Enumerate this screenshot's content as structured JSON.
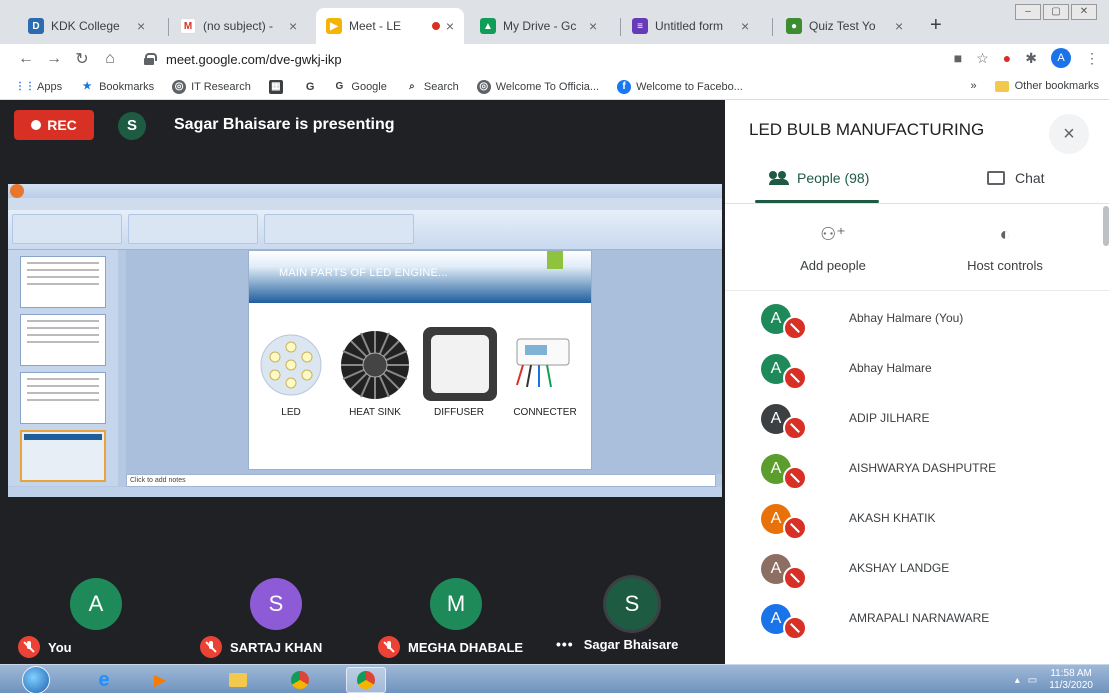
{
  "browser": {
    "tabs": [
      {
        "title": "KDK College",
        "favicon_color": "#2b6cb0",
        "favicon": "D"
      },
      {
        "title": "(no subject) -",
        "favicon_color": "#ffffff",
        "favicon": "M"
      },
      {
        "title": "Meet - LE",
        "favicon_color": "#f4b400",
        "favicon": "▶"
      },
      {
        "title": "My Drive - Gc",
        "favicon_color": "#0f9d58",
        "favicon": "▲"
      },
      {
        "title": "Untitled form",
        "favicon_color": "#673ab7",
        "favicon": "≡"
      },
      {
        "title": "Quiz Test Yo",
        "favicon_color": "#3c8d2f",
        "favicon": "●"
      }
    ],
    "url": "meet.google.com/dve-gwkj-ikp",
    "profile_initial": "A",
    "bookmarks": [
      "Apps",
      "Bookmarks",
      "IT Research",
      "Google",
      "Search",
      "Welcome To Officia...",
      "Welcome to Facebo..."
    ],
    "bookmarks_g": "G",
    "bookmarks_more": "»",
    "other_bookmarks": "Other bookmarks"
  },
  "meet": {
    "rec_label": "REC",
    "presenter_initial": "S",
    "presenter_color": "#1e5b43",
    "presenting_text": "Sagar Bhaisare is presenting",
    "slide": {
      "title": "MAIN PARTS OF LED ENGINE...",
      "parts": [
        "LED",
        "HEAT SINK",
        "DIFFUSER",
        "CONNECTER"
      ],
      "notes_placeholder": "Click to add notes"
    },
    "participants": [
      {
        "initial": "A",
        "color": "#1e8a5a",
        "name": "You",
        "indicator": "mic-off"
      },
      {
        "initial": "S",
        "color": "#8e5bd6",
        "name": "SARTAJ KHAN",
        "indicator": "mic-off"
      },
      {
        "initial": "M",
        "color": "#1e8a5a",
        "name": "MEGHA DHABALE",
        "indicator": "mic-off"
      },
      {
        "initial": "S",
        "color": "#1e5b43",
        "name": "Sagar Bhaisare",
        "indicator": "dots"
      }
    ]
  },
  "panel": {
    "title": "LED BULB MANUFACTURING",
    "close": "×",
    "tab_people": "People (98)",
    "tab_chat": "Chat",
    "add_people": "Add people",
    "host_controls": "Host controls",
    "people": [
      {
        "initial": "A",
        "color": "#1e8a5a",
        "name": "Abhay Halmare (You)"
      },
      {
        "initial": "A",
        "color": "#1e8a5a",
        "name": "Abhay Halmare"
      },
      {
        "initial": "A",
        "color": "#3c4043",
        "name": "ADIP JILHARE"
      },
      {
        "initial": "A",
        "color": "#5b9e2e",
        "name": "AISHWARYA DASHPUTRE"
      },
      {
        "initial": "A",
        "color": "#e8710a",
        "name": "AKASH KHATIK"
      },
      {
        "initial": "A",
        "color": "#8d6e63",
        "name": "AKSHAY LANDGE"
      },
      {
        "initial": "A",
        "color": "#1a73e8",
        "name": "AMRAPALI NARNAWARE"
      }
    ]
  },
  "taskbar": {
    "time": "11:58 AM",
    "date": "11/3/2020"
  }
}
